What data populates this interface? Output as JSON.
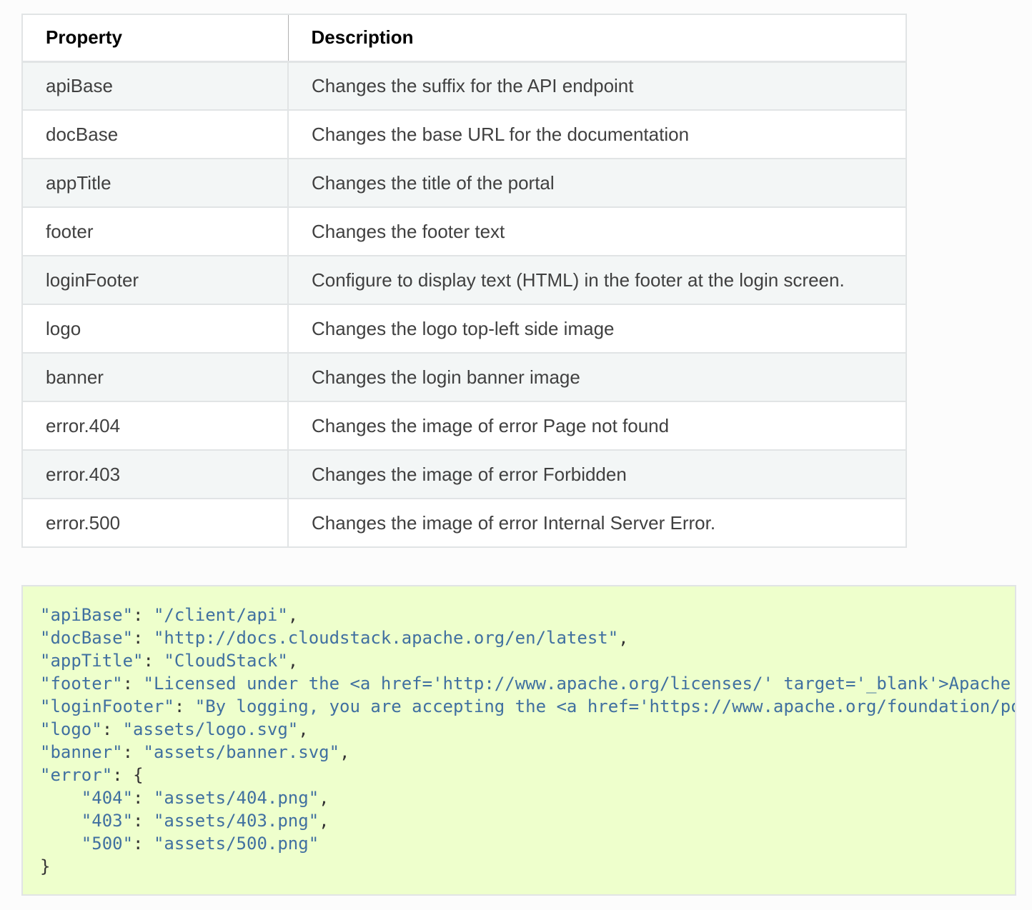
{
  "table": {
    "headers": {
      "property": "Property",
      "description": "Description"
    },
    "rows": [
      {
        "property": "apiBase",
        "description": "Changes the suffix for the API endpoint"
      },
      {
        "property": "docBase",
        "description": "Changes the base URL for the documentation"
      },
      {
        "property": "appTitle",
        "description": "Changes the title of the portal"
      },
      {
        "property": "footer",
        "description": "Changes the footer text"
      },
      {
        "property": "loginFooter",
        "description": "Configure to display text (HTML) in the footer at the login screen."
      },
      {
        "property": "logo",
        "description": "Changes the logo top-left side image"
      },
      {
        "property": "banner",
        "description": "Changes the login banner image"
      },
      {
        "property": "error.404",
        "description": "Changes the image of error Page not found"
      },
      {
        "property": "error.403",
        "description": "Changes the image of error Forbidden"
      },
      {
        "property": "error.500",
        "description": "Changes the image of error Internal Server Error."
      }
    ]
  },
  "code": {
    "lines": [
      {
        "key": "\"apiBase\"",
        "sep": ": ",
        "value": "\"/client/api\"",
        "end": ","
      },
      {
        "key": "\"docBase\"",
        "sep": ": ",
        "value": "\"http://docs.cloudstack.apache.org/en/latest\"",
        "end": ","
      },
      {
        "key": "\"appTitle\"",
        "sep": ": ",
        "value": "\"CloudStack\"",
        "end": ","
      },
      {
        "key": "\"footer\"",
        "sep": ": ",
        "value": "\"Licensed under the <a href='http://www.apache.org/licenses/' target='_blank'>Apache",
        "end": ""
      },
      {
        "key": "\"loginFooter\"",
        "sep": ": ",
        "value": "\"By logging, you are accepting the <a href='https://www.apache.org/foundation/po",
        "end": ""
      },
      {
        "key": "\"logo\"",
        "sep": ": ",
        "value": "\"assets/logo.svg\"",
        "end": ","
      },
      {
        "key": "\"banner\"",
        "sep": ": ",
        "value": "\"assets/banner.svg\"",
        "end": ","
      },
      {
        "key": "\"error\"",
        "sep": ": ",
        "value": "",
        "end": "{"
      },
      {
        "key": "    \"404\"",
        "sep": ": ",
        "value": "\"assets/404.png\"",
        "end": ","
      },
      {
        "key": "    \"403\"",
        "sep": ": ",
        "value": "\"assets/403.png\"",
        "end": ","
      },
      {
        "key": "    \"500\"",
        "sep": ": ",
        "value": "\"assets/500.png\"",
        "end": ""
      },
      {
        "key": "",
        "sep": "",
        "value": "",
        "end": "}"
      }
    ]
  },
  "colors": {
    "code_background": "#eeffcc",
    "code_string": "#4070a0",
    "table_stripe": "#f3f6f6",
    "table_border": "#e1e4e5"
  }
}
